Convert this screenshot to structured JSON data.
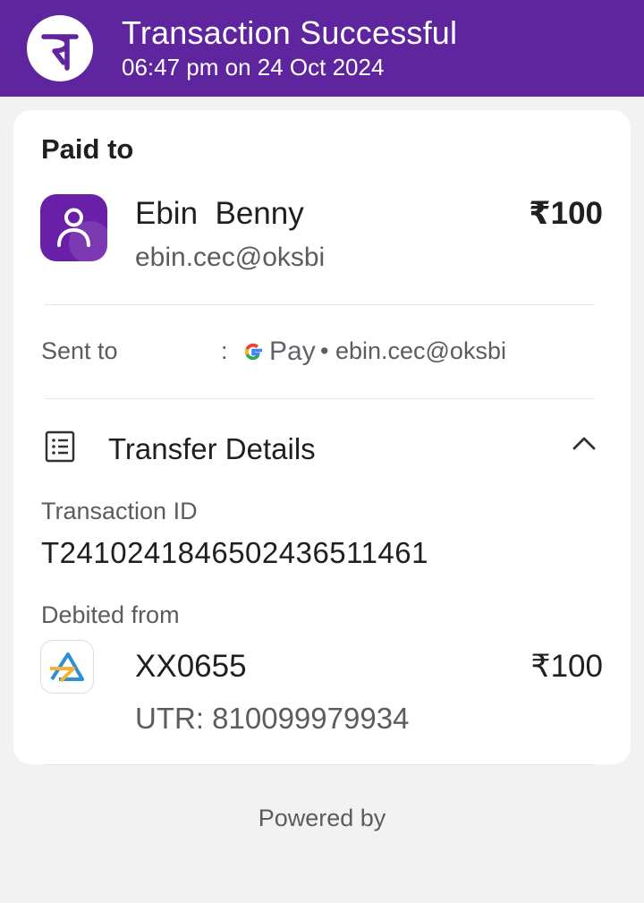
{
  "header": {
    "logo_icon": "phonepe-logo-icon",
    "title": "Transaction Successful",
    "subtitle": "06:47 pm on 24 Oct 2024",
    "bg_color": "#5f259f"
  },
  "paid_to": {
    "heading": "Paid to",
    "avatar_icon": "person-icon",
    "name": "Ebin  Benny",
    "upi_id": "ebin.cec@oksbi",
    "amount": "₹100"
  },
  "sent_to": {
    "label": "Sent to",
    "colon": ":",
    "app_icon": "google-g-icon",
    "app_name": "Pay",
    "upi": "• ebin.cec@oksbi"
  },
  "transfer_details": {
    "label": "Transfer Details",
    "icon": "receipt-icon",
    "toggle_icon": "chevron-up-icon",
    "transaction_id_label": "Transaction ID",
    "transaction_id": "T2410241846502436511461",
    "debited_from_label": "Debited from",
    "bank_icon": "bank-logo-icon",
    "account": "XX0655",
    "amount": "₹100",
    "utr": "UTR: 810099979934"
  },
  "footer": {
    "powered_by": "Powered by"
  }
}
